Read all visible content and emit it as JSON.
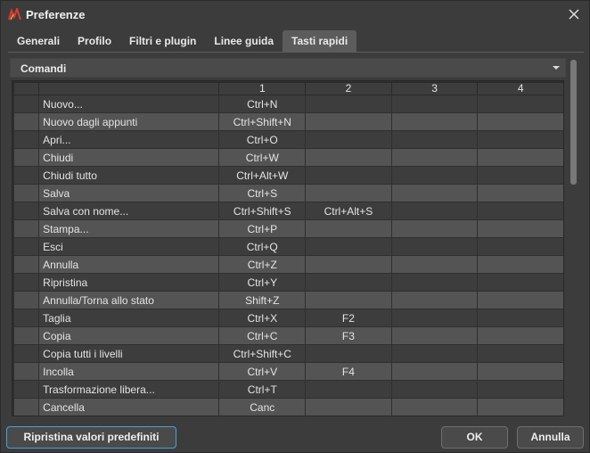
{
  "window": {
    "title": "Preferenze",
    "app_icon": "aks-logo-icon",
    "close_icon": "close-icon"
  },
  "tabs": [
    {
      "label": "Generali",
      "active": false
    },
    {
      "label": "Profilo",
      "active": false
    },
    {
      "label": "Filtri e plugin",
      "active": false
    },
    {
      "label": "Linee guida",
      "active": false
    },
    {
      "label": "Tasti rapidi",
      "active": true
    }
  ],
  "dropdown": {
    "selected": "Comandi",
    "icon": "chevron-down-icon"
  },
  "grid": {
    "headers": [
      "",
      "",
      "1",
      "2",
      "3",
      "4"
    ],
    "rows": [
      {
        "name": "Nuovo...",
        "k1": "Ctrl+N",
        "k2": "",
        "k3": "",
        "k4": ""
      },
      {
        "name": "Nuovo dagli appunti",
        "k1": "Ctrl+Shift+N",
        "k2": "",
        "k3": "",
        "k4": ""
      },
      {
        "name": "Apri...",
        "k1": "Ctrl+O",
        "k2": "",
        "k3": "",
        "k4": ""
      },
      {
        "name": "Chiudi",
        "k1": "Ctrl+W",
        "k2": "",
        "k3": "",
        "k4": ""
      },
      {
        "name": "Chiudi tutto",
        "k1": "Ctrl+Alt+W",
        "k2": "",
        "k3": "",
        "k4": ""
      },
      {
        "name": "Salva",
        "k1": "Ctrl+S",
        "k2": "",
        "k3": "",
        "k4": ""
      },
      {
        "name": "Salva con nome...",
        "k1": "Ctrl+Shift+S",
        "k2": "Ctrl+Alt+S",
        "k3": "",
        "k4": ""
      },
      {
        "name": "Stampa...",
        "k1": "Ctrl+P",
        "k2": "",
        "k3": "",
        "k4": ""
      },
      {
        "name": "Esci",
        "k1": "Ctrl+Q",
        "k2": "",
        "k3": "",
        "k4": ""
      },
      {
        "name": "Annulla",
        "k1": "Ctrl+Z",
        "k2": "",
        "k3": "",
        "k4": ""
      },
      {
        "name": "Ripristina",
        "k1": "Ctrl+Y",
        "k2": "",
        "k3": "",
        "k4": ""
      },
      {
        "name": "Annulla/Torna allo stato",
        "k1": "Shift+Z",
        "k2": "",
        "k3": "",
        "k4": ""
      },
      {
        "name": "Taglia",
        "k1": "Ctrl+X",
        "k2": "F2",
        "k3": "",
        "k4": ""
      },
      {
        "name": "Copia",
        "k1": "Ctrl+C",
        "k2": "F3",
        "k3": "",
        "k4": ""
      },
      {
        "name": "Copia tutti i livelli",
        "k1": "Ctrl+Shift+C",
        "k2": "",
        "k3": "",
        "k4": ""
      },
      {
        "name": "Incolla",
        "k1": "Ctrl+V",
        "k2": "F4",
        "k3": "",
        "k4": ""
      },
      {
        "name": "Trasformazione libera...",
        "k1": "Ctrl+T",
        "k2": "",
        "k3": "",
        "k4": ""
      },
      {
        "name": "Cancella",
        "k1": "Canc",
        "k2": "",
        "k3": "",
        "k4": ""
      }
    ]
  },
  "buttons": {
    "reset": "Ripristina valori predefiniti",
    "ok": "OK",
    "cancel": "Annulla"
  },
  "colors": {
    "background": "#3c3c3c",
    "active_tab": "#5c5c5c",
    "row_light": "#545454",
    "row_dark": "#3d3d3d",
    "focus_border": "#49a2d9",
    "logo_red": "#e03a2f"
  }
}
